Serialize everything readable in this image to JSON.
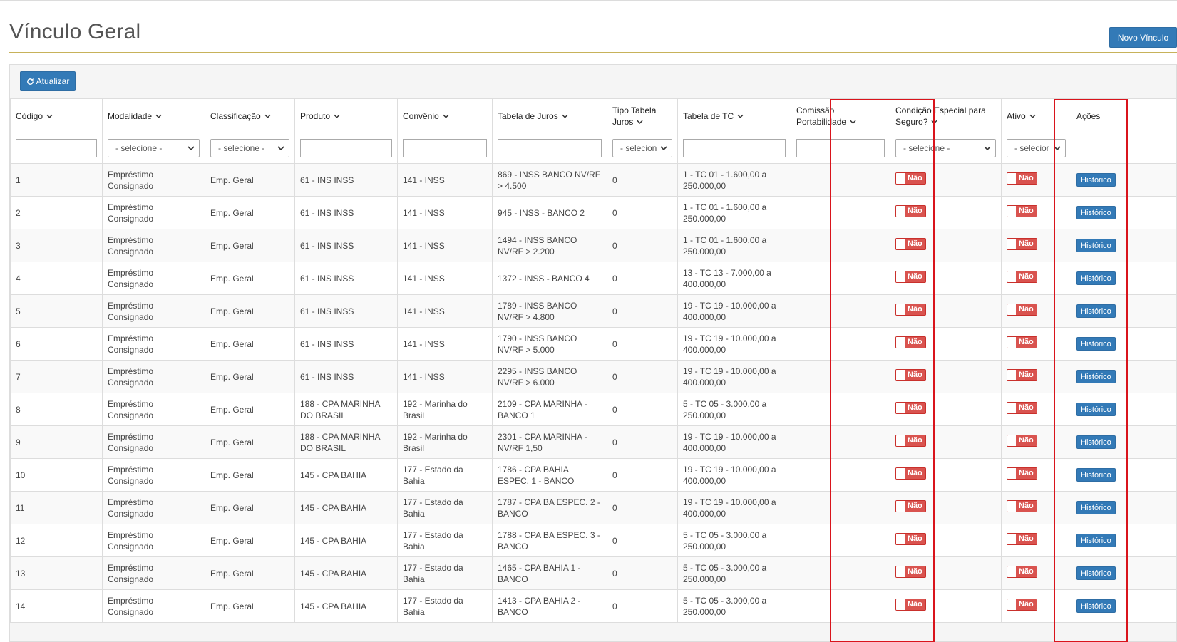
{
  "page": {
    "title": "Vínculo Geral"
  },
  "toolbar": {
    "novo_label": "Novo Vínculo",
    "atualizar_label": "Atualizar"
  },
  "colors": {
    "primary": "#337ab7",
    "danger": "#d9534f",
    "highlight": "#d9141c",
    "rule": "#c7b25a"
  },
  "table": {
    "headers": {
      "codigo": "Código",
      "modalidade": "Modalidade",
      "classificacao": "Classificação",
      "produto": "Produto",
      "convenio": "Convênio",
      "tabela_juros": "Tabela de Juros",
      "tipo_tabela_juros": "Tipo Tabela Juros",
      "tabela_tc": "Tabela de TC",
      "comissao_portabilidade": "Comissão Portabilidade",
      "condicao_especial": "Condição Especial para Seguro?",
      "ativo": "Ativo",
      "acoes": "Ações"
    },
    "filters": {
      "modalidade": "- selecione -",
      "classificacao": "- selecione -",
      "tipo_tabela_juros": "- selecion",
      "condicao_especial": "- selecione -",
      "ativo": "- selecior"
    },
    "toggle_label": "Não",
    "historico_label": "Histórico",
    "rows": [
      {
        "codigo": "1",
        "modalidade": "Empréstimo Consignado",
        "classificacao": "Emp. Geral",
        "produto": "61 - INS INSS",
        "convenio": "141 - INSS",
        "tabela_juros": "869 - INSS BANCO NV/RF > 4.500",
        "tipo": "0",
        "tabela_tc": "1 - TC 01 - 1.600,00 a 250.000,00"
      },
      {
        "codigo": "2",
        "modalidade": "Empréstimo Consignado",
        "classificacao": "Emp. Geral",
        "produto": "61 - INS INSS",
        "convenio": "141 - INSS",
        "tabela_juros": "945 - INSS - BANCO 2",
        "tipo": "0",
        "tabela_tc": "1 - TC 01 - 1.600,00 a 250.000,00"
      },
      {
        "codigo": "3",
        "modalidade": "Empréstimo Consignado",
        "classificacao": "Emp. Geral",
        "produto": "61 - INS INSS",
        "convenio": "141 - INSS",
        "tabela_juros": "1494 - INSS BANCO NV/RF > 2.200",
        "tipo": "0",
        "tabela_tc": "1 - TC 01 - 1.600,00 a 250.000,00"
      },
      {
        "codigo": "4",
        "modalidade": "Empréstimo Consignado",
        "classificacao": "Emp. Geral",
        "produto": "61 - INS INSS",
        "convenio": "141 - INSS",
        "tabela_juros": "1372 - INSS - BANCO 4",
        "tipo": "0",
        "tabela_tc": "13 - TC 13 - 7.000,00 a 400.000,00"
      },
      {
        "codigo": "5",
        "modalidade": "Empréstimo Consignado",
        "classificacao": "Emp. Geral",
        "produto": "61 - INS INSS",
        "convenio": "141 - INSS",
        "tabela_juros": "1789 - INSS BANCO NV/RF > 4.800",
        "tipo": "0",
        "tabela_tc": "19 - TC 19 - 10.000,00 a 400.000,00"
      },
      {
        "codigo": "6",
        "modalidade": "Empréstimo Consignado",
        "classificacao": "Emp. Geral",
        "produto": "61 - INS INSS",
        "convenio": "141 - INSS",
        "tabela_juros": "1790 - INSS BANCO NV/RF > 5.000",
        "tipo": "0",
        "tabela_tc": "19 - TC 19 - 10.000,00 a 400.000,00"
      },
      {
        "codigo": "7",
        "modalidade": "Empréstimo Consignado",
        "classificacao": "Emp. Geral",
        "produto": "61 - INS INSS",
        "convenio": "141 - INSS",
        "tabela_juros": "2295 - INSS BANCO NV/RF > 6.000",
        "tipo": "0",
        "tabela_tc": "19 - TC 19 - 10.000,00 a 400.000,00"
      },
      {
        "codigo": "8",
        "modalidade": "Empréstimo Consignado",
        "classificacao": "Emp. Geral",
        "produto": "188 - CPA MARINHA DO BRASIL",
        "convenio": "192 - Marinha do Brasil",
        "tabela_juros": "2109 - CPA MARINHA - BANCO 1",
        "tipo": "0",
        "tabela_tc": "5 - TC 05 - 3.000,00 a 250.000,00"
      },
      {
        "codigo": "9",
        "modalidade": "Empréstimo Consignado",
        "classificacao": "Emp. Geral",
        "produto": "188 - CPA MARINHA DO BRASIL",
        "convenio": "192 - Marinha do Brasil",
        "tabela_juros": "2301 - CPA MARINHA - NV/RF 1,50",
        "tipo": "0",
        "tabela_tc": "19 - TC 19 - 10.000,00 a 400.000,00"
      },
      {
        "codigo": "10",
        "modalidade": "Empréstimo Consignado",
        "classificacao": "Emp. Geral",
        "produto": "145 - CPA BAHIA",
        "convenio": "177 - Estado da Bahia",
        "tabela_juros": "1786 - CPA BAHIA ESPEC. 1 - BANCO",
        "tipo": "0",
        "tabela_tc": "19 - TC 19 - 10.000,00 a 400.000,00"
      },
      {
        "codigo": "11",
        "modalidade": "Empréstimo Consignado",
        "classificacao": "Emp. Geral",
        "produto": "145 - CPA BAHIA",
        "convenio": "177 - Estado da Bahia",
        "tabela_juros": "1787 - CPA BA ESPEC. 2 - BANCO",
        "tipo": "0",
        "tabela_tc": "19 - TC 19 - 10.000,00 a 400.000,00"
      },
      {
        "codigo": "12",
        "modalidade": "Empréstimo Consignado",
        "classificacao": "Emp. Geral",
        "produto": "145 - CPA BAHIA",
        "convenio": "177 - Estado da Bahia",
        "tabela_juros": "1788 - CPA BA ESPEC. 3 - BANCO",
        "tipo": "0",
        "tabela_tc": "5 - TC 05 - 3.000,00 a 250.000,00"
      },
      {
        "codigo": "13",
        "modalidade": "Empréstimo Consignado",
        "classificacao": "Emp. Geral",
        "produto": "145 - CPA BAHIA",
        "convenio": "177 - Estado da Bahia",
        "tabela_juros": "1465 - CPA BAHIA 1 - BANCO",
        "tipo": "0",
        "tabela_tc": "5 - TC 05 - 3.000,00 a 250.000,00"
      },
      {
        "codigo": "14",
        "modalidade": "Empréstimo Consignado",
        "classificacao": "Emp. Geral",
        "produto": "145 - CPA BAHIA",
        "convenio": "177 - Estado da Bahia",
        "tabela_juros": "1413 - CPA BAHIA 2 - BANCO",
        "tipo": "0",
        "tabela_tc": "5 - TC 05 - 3.000,00 a 250.000,00"
      }
    ]
  }
}
